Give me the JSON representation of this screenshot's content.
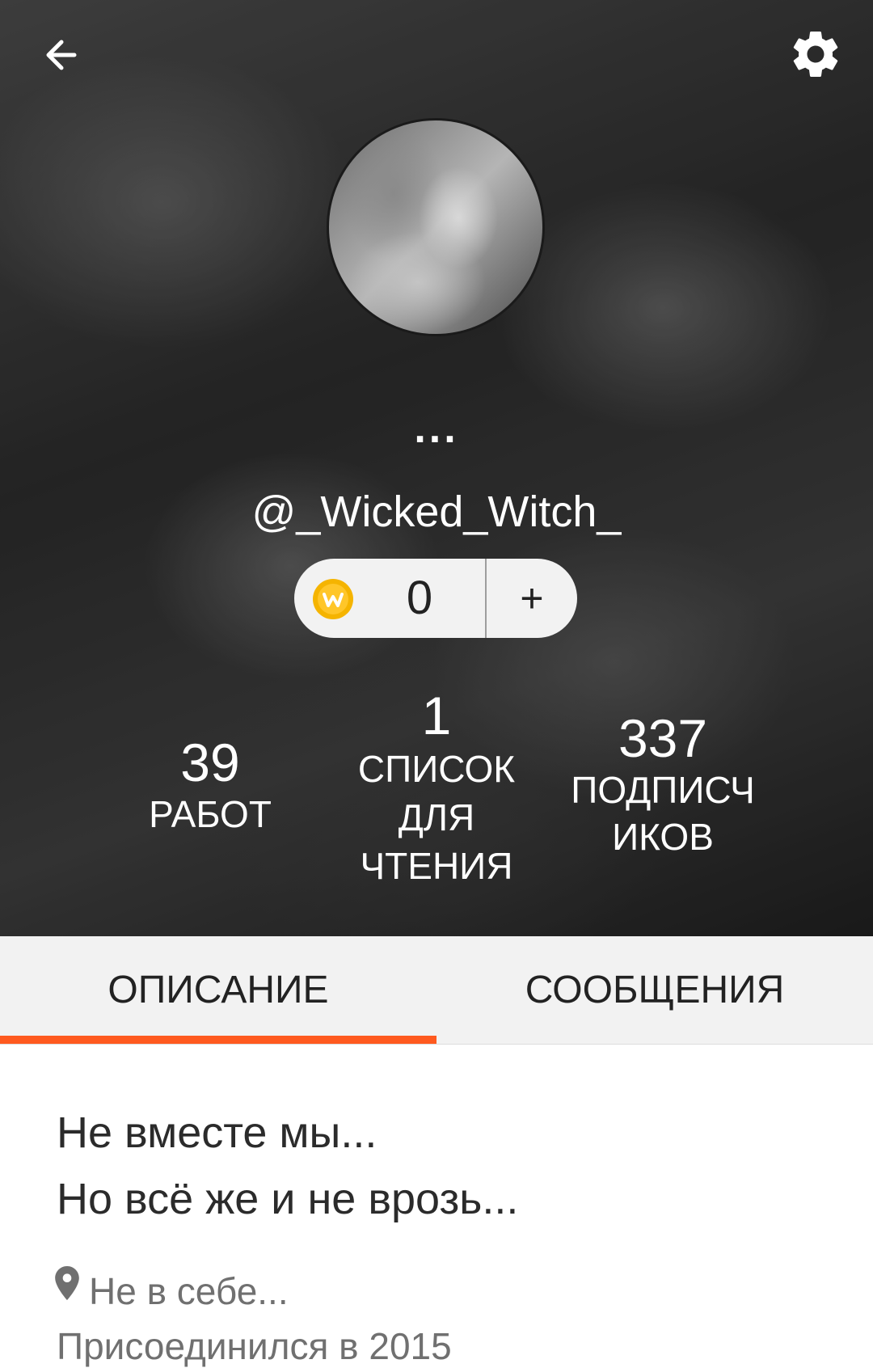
{
  "header": {
    "display_name": "...",
    "username": "@_Wicked_Witch_"
  },
  "coins": {
    "count": "0",
    "add_label": "+"
  },
  "stats": {
    "works_count": "39",
    "works_label": "РАБОТ",
    "lists_count": "1",
    "lists_label_1": "СПИСОК",
    "lists_label_2": "ДЛЯ",
    "lists_label_3": "ЧТЕНИЯ",
    "followers_count": "337",
    "followers_label_1": "ПОДПИСЧ",
    "followers_label_2": "ИКОВ"
  },
  "tabs": [
    {
      "label": "ОПИСАНИЕ",
      "active": true
    },
    {
      "label": "СООБЩЕНИЯ",
      "active": false
    }
  ],
  "about": {
    "description_line_1": "Не вместе мы...",
    "description_line_2": "Но всё же и не врозь...",
    "location": "Не в себе...",
    "joined_partial": "Присоединился в 2015"
  },
  "colors": {
    "accent": "#ff5a1f",
    "coin": "#f5b400"
  },
  "icons": {
    "back": "arrow-left-icon",
    "settings": "gear-icon",
    "coin": "wattpad-coin-icon",
    "location": "location-pin-icon"
  }
}
